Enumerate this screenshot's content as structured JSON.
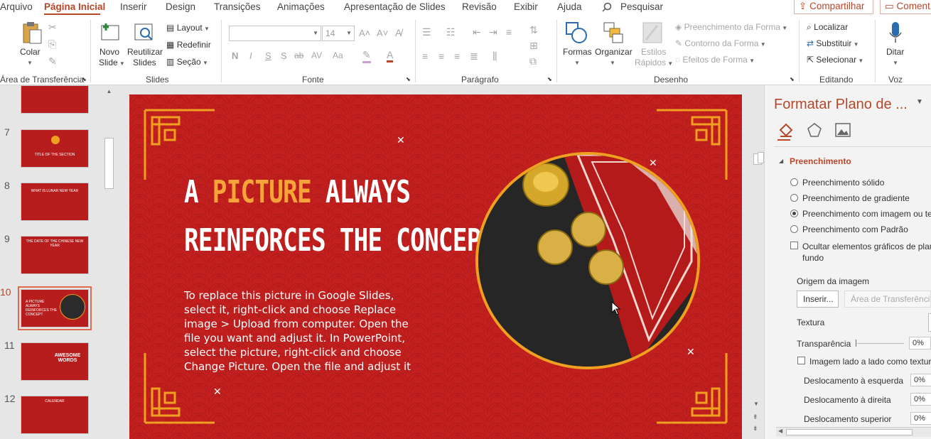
{
  "tabs": [
    "Arquivo",
    "Página Inicial",
    "Inserir",
    "Design",
    "Transições",
    "Animações",
    "Apresentação de Slides",
    "Revisão",
    "Exibir",
    "Ajuda",
    "Pesquisar"
  ],
  "share": {
    "share_label": "Compartilhar",
    "comments_label": "Coment"
  },
  "ribbon": {
    "clipboard": {
      "paste": "Colar",
      "group": "Área de Transferência"
    },
    "slides": {
      "new_slide_1": "Novo",
      "new_slide_2": "Slide",
      "reuse_1": "Reutilizar",
      "reuse_2": "Slides",
      "layout": "Layout",
      "reset": "Redefinir",
      "section": "Seção",
      "group": "Slides"
    },
    "font": {
      "size": "14",
      "group": "Fonte",
      "bold": "N",
      "italic": "I",
      "underline": "S",
      "shadow": "S",
      "strike": "ab",
      "spacing": "AV",
      "case": "Aa"
    },
    "paragraph": {
      "group": "Parágrafo"
    },
    "drawing": {
      "shapes": "Formas",
      "arrange": "Organizar",
      "quick_styles_1": "Estilos",
      "quick_styles_2": "Rápidos",
      "fill": "Preenchimento da Forma",
      "outline": "Contorno da Forma",
      "effects": "Efeitos de Forma",
      "group": "Desenho"
    },
    "editing": {
      "find": "Localizar",
      "replace": "Substituir",
      "select": "Selecionar",
      "group": "Editando"
    },
    "voice": {
      "dictate": "Ditar",
      "group": "Voz"
    }
  },
  "thumbnails": [
    {
      "num": "7",
      "text": "TITLE OF THE SECTION"
    },
    {
      "num": "8",
      "text": "WHAT IS LUNAR NEW YEAR"
    },
    {
      "num": "9",
      "text": "THE DATE OF THE CHINESE NEW YEAR"
    },
    {
      "num": "10",
      "text": "A PICTURE ALWAYS REINFORCES THE CONCEPT"
    },
    {
      "num": "11",
      "text": "AWESOME WORDS"
    },
    {
      "num": "12",
      "text": "CALENDAR"
    }
  ],
  "slide": {
    "title_l1_a": "A ",
    "title_l1_b": "PICTURE",
    "title_l1_c": " ALWAYS",
    "title_l2": "REINFORCES THE CONCEPT",
    "body": "To replace this picture in Google Slides, select it, right-click and choose Replace image > Upload from computer. Open the file you want and adjust it. In PowerPoint, select the picture, right-click and choose Change Picture. Open the file and adjust it",
    "colors": {
      "bg": "#c21f1f",
      "accent": "#f6a43a",
      "frame": "#f0a020"
    }
  },
  "pane": {
    "title": "Formatar Plano de ...",
    "section": "Preenchimento",
    "options": [
      "Preenchimento sólido",
      "Preenchimento de gradiente",
      "Preenchimento com imagem ou te",
      "Preenchimento com Padrão"
    ],
    "hide_graphics_1": "Ocultar elementos gráficos de plan",
    "hide_graphics_2": "fundo",
    "image_source": "Origem da imagem",
    "insert_btn": "Inserir...",
    "clipboard_btn": "Área de Transferência",
    "texture": "Textura",
    "transparency": "Transparência",
    "transparency_val": "0%",
    "tile": "Imagem lado a lado como textur",
    "offset_left": "Deslocamento à esquerda",
    "offset_right": "Deslocamento à direita",
    "offset_top": "Deslocamento superior",
    "offset_val": "0%"
  }
}
